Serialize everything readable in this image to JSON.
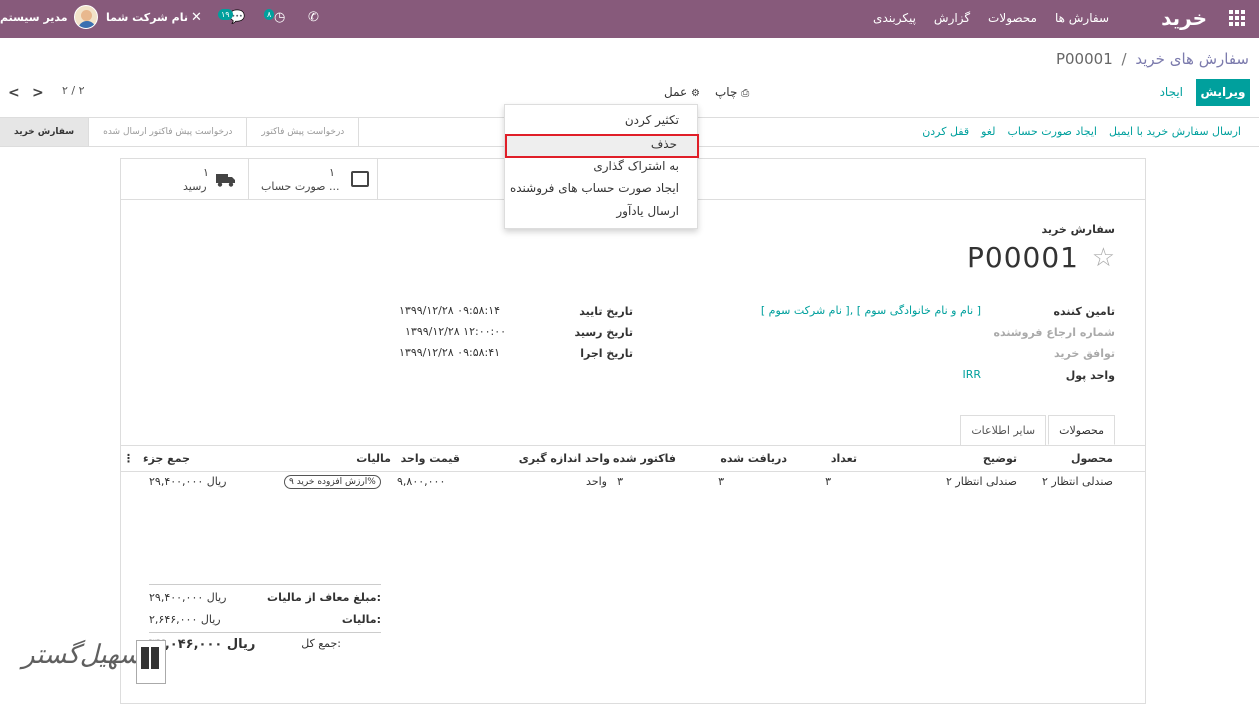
{
  "topbar": {
    "brand": "خرید",
    "menu": [
      "سفارش ها",
      "محصولات",
      "گزارش",
      "پیکربندی"
    ],
    "company": "نام شرکت شما",
    "user": "مدیر سیستم",
    "activity_count": "۸",
    "messages_count": "۱۹"
  },
  "breadcrumb": {
    "parent": "سفارش های خرید",
    "separator": "/",
    "current": "P00001"
  },
  "controls": {
    "edit": "ویرایش",
    "create": "ایجاد",
    "print": "چاپ",
    "action": "عمل",
    "pager": "۲ / ۲",
    "prev": "<",
    "next": ">"
  },
  "status_actions": [
    "ارسال سفارش خرید با ایمیل",
    "ایجاد صورت حساب",
    "لغو",
    "قفل کردن"
  ],
  "stages": [
    "درخواست پیش فاکتور",
    "درخواست پیش فاکتور ارسال شده",
    "سفارش خرید"
  ],
  "smart_buttons": {
    "receipt": {
      "count": "۱",
      "label": "رسید"
    },
    "bill": {
      "count": "۱",
      "label": "صورت حساب ..."
    }
  },
  "form": {
    "title_label": "سفارش خرید",
    "name": "P00001",
    "left": [
      {
        "label": "تامین کننده",
        "value": "[ نام شرکت سوم ], [ نام و نام خانوادگی سوم ]",
        "muted": false
      },
      {
        "label": "شماره ارجاع فروشنده",
        "value": "",
        "muted": true
      },
      {
        "label": "توافق خرید",
        "value": "",
        "muted": true
      },
      {
        "label": "واحد پول",
        "value": "IRR",
        "muted": false
      }
    ],
    "right": [
      {
        "label": "تاریخ تایید",
        "value": "۱۳۹۹/۱۲/۲۸ ۰۹:۵۸:۱۴"
      },
      {
        "label": "تاریخ رسید",
        "value": "۱۳۹۹/۱۲/۲۸ ۱۲:۰۰:۰۰"
      },
      {
        "label": "تاریخ اجرا",
        "value": "۱۳۹۹/۱۲/۲۸ ۰۹:۵۸:۴۱"
      }
    ]
  },
  "tabs": [
    "محصولات",
    "سایر اطلاعات"
  ],
  "table": {
    "headers": [
      "محصول",
      "توضیح",
      "تعداد",
      "دریافت شده",
      "فاکتور شده",
      "واحد اندازه گیری",
      "قیمت واحد",
      "مالیات",
      "جمع جزء"
    ],
    "row": {
      "product": "صندلی انتظار ۲",
      "description": "صندلی انتظار ۲",
      "qty": "۳",
      "received": "۳",
      "invoiced": "۳",
      "uom": "واحد",
      "price": "۹,۸۰۰,۰۰۰",
      "tax": "ارزش افزوده خرید ۹%",
      "subtotal": "۲۹,۴۰۰,۰۰۰ ریال"
    }
  },
  "totals": {
    "untaxed_label": "مبلغ معاف از مالیات:",
    "untaxed": "۲۹,۴۰۰,۰۰۰ ریال",
    "tax_label": "مالیات:",
    "tax": "۲,۶۴۶,۰۰۰ ریال",
    "total_label": "جمع کل:",
    "total": "۳۲,۰۴۶,۰۰۰ ریال"
  },
  "dropdown": [
    "تکثیر کردن",
    "حذف",
    "به اشتراک گذاری",
    "ایجاد صورت حساب های فروشنده",
    "ارسال یادآور"
  ],
  "watermark": "تسهیل‌گستر",
  "colors": {
    "navbar": "#875A7B",
    "primary": "#00A09D",
    "highlight_border": "#e01e28"
  }
}
